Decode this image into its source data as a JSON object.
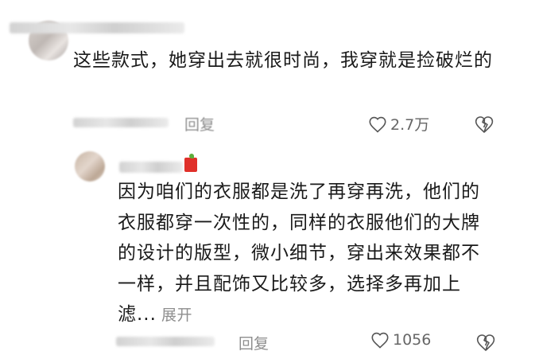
{
  "comment1": {
    "text": "这些款式，她穿出去就很时尚，我穿就是捡破烂的",
    "reply_label": "回复",
    "like_count": "2.7万"
  },
  "comment2": {
    "text": "因为咱们的衣服都是洗了再穿再洗，他们的衣服都穿一次性的，同样的衣服他们的大牌的设计的版型，微小细节，穿出来效果都不一样，并且配饰又比较多，选择多再加上滤...",
    "expand_label": "展开",
    "reply_label": "回复",
    "like_count": "1056"
  },
  "icons": {
    "like": "heart-outline-icon",
    "dislike": "broken-heart-icon"
  },
  "colors": {
    "text": "#1a1a1a",
    "meta": "#8e8e8e",
    "badge": "#e0302a"
  }
}
